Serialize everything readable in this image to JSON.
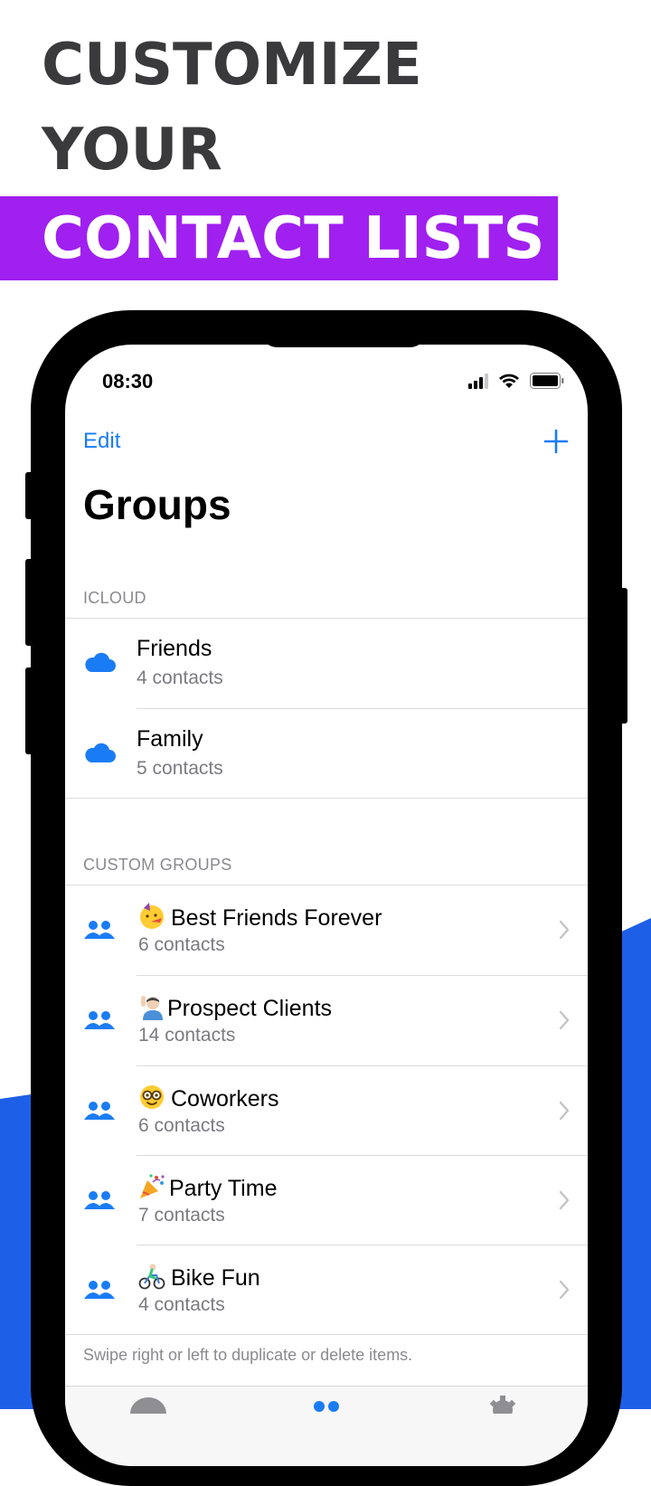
{
  "headline": {
    "line1": "CUSTOMIZE",
    "line2": "YOUR",
    "line3": "CONTACT LISTS"
  },
  "colors": {
    "accent_purple": "#a020f0",
    "ios_blue": "#1a7cf5",
    "wave_blue": "#1e5fe8"
  },
  "status_bar": {
    "time": "08:30",
    "icons": [
      "cellular-signal-icon",
      "wifi-icon",
      "battery-icon"
    ]
  },
  "nav": {
    "edit_label": "Edit",
    "add_icon": "plus-icon",
    "title": "Groups"
  },
  "sections": {
    "icloud_header": "ICLOUD",
    "custom_header": "CUSTOM GROUPS"
  },
  "icloud_groups": [
    {
      "title": "Friends",
      "subtitle": "4 contacts",
      "icon": "cloud-icon"
    },
    {
      "title": "Family",
      "subtitle": "5 contacts",
      "icon": "cloud-icon"
    }
  ],
  "custom_groups": [
    {
      "emoji": "party-face-icon",
      "title": "Best Friends Forever",
      "subtitle": "6 contacts",
      "icon": "people-icon"
    },
    {
      "emoji": "person-raising-hand-icon",
      "title": "Prospect Clients",
      "subtitle": "14 contacts",
      "icon": "people-icon"
    },
    {
      "emoji": "nerd-face-icon",
      "title": "Coworkers",
      "subtitle": "6 contacts",
      "icon": "people-icon"
    },
    {
      "emoji": "party-popper-icon",
      "title": "Party Time",
      "subtitle": "7 contacts",
      "icon": "people-icon"
    },
    {
      "emoji": "person-biking-icon",
      "title": "Bike Fun",
      "subtitle": "4 contacts",
      "icon": "people-icon"
    }
  ],
  "footer_note": "Swipe right or left to duplicate or delete items."
}
